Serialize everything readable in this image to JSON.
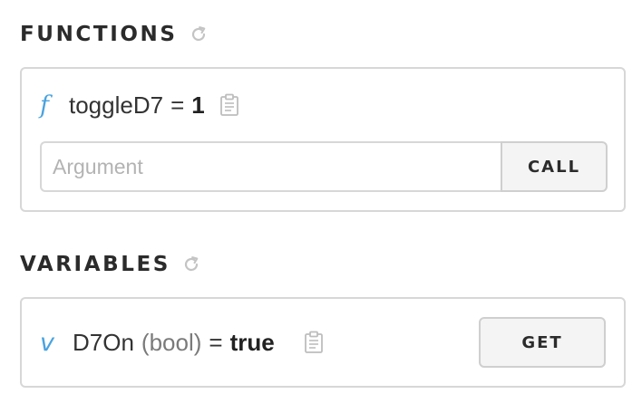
{
  "functions": {
    "title": "FUNCTIONS",
    "refresh_icon": "refresh-icon",
    "items": [
      {
        "type_glyph": "f",
        "name": "toggleD7",
        "equals": "=",
        "result": "1",
        "copy_icon": "clipboard-icon",
        "argument_placeholder": "Argument",
        "argument_value": "",
        "call_label": "CALL"
      }
    ]
  },
  "variables": {
    "title": "VARIABLES",
    "refresh_icon": "refresh-icon",
    "items": [
      {
        "type_glyph": "v",
        "name": "D7On",
        "type": "(bool)",
        "equals": "=",
        "value": "true",
        "copy_icon": "clipboard-icon",
        "get_label": "GET"
      }
    ]
  },
  "colors": {
    "accent": "#4aa3df",
    "border": "#d7d7d7",
    "button_bg": "#f4f4f4",
    "text": "#333333",
    "muted": "#7a7a7a",
    "placeholder": "#b3b3b3"
  }
}
